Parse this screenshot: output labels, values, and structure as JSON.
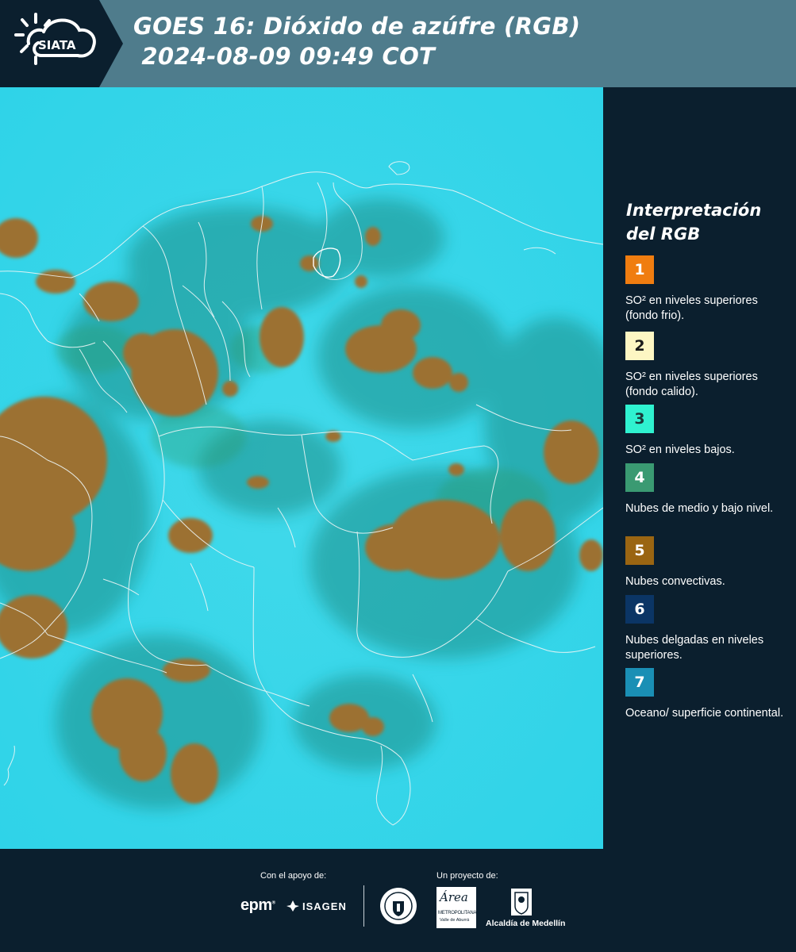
{
  "header": {
    "logo_text": "SIATA",
    "title_line1": "GOES 16: Dióxido de azúfre (RGB)",
    "title_line2": " 2024-08-09 09:49 COT"
  },
  "legend": {
    "title_line1": "Interpretación",
    "title_line2": "del RGB",
    "items": [
      {
        "number": "1",
        "color": "#f07d10",
        "text_color": "#ffffff",
        "label": "SO² en niveles superiores (fondo frio)."
      },
      {
        "number": "2",
        "color": "#fdf6c3",
        "text_color": "#1a1a1a",
        "label": "SO² en niveles superiores (fondo calido)."
      },
      {
        "number": "3",
        "color": "#2ff2d0",
        "text_color": "#1a3a3a",
        "label": "SO² en niveles bajos."
      },
      {
        "number": "4",
        "color": "#3a9a72",
        "text_color": "#ffffff",
        "label": "Nubes de medio y bajo nivel."
      },
      {
        "number": "5",
        "color": "#9a6512",
        "text_color": "#ffffff",
        "label": "Nubes convectivas."
      },
      {
        "number": "6",
        "color": "#0b3565",
        "text_color": "#ffffff",
        "label": "Nubes delgadas en niveles superiores."
      },
      {
        "number": "7",
        "color": "#1a8fb5",
        "text_color": "#ffffff",
        "label": "Oceano/ superficie continental."
      }
    ]
  },
  "footer": {
    "support_label": "Con el apoyo de:",
    "project_label": "Un proyecto de:",
    "sponsor_epm": "epm",
    "sponsor_isagen": "ISAGEN",
    "area_name": "Área",
    "area_sub1": "METROPOLITANA",
    "area_sub2": "Valle de Aburrá",
    "alcaldia": "Alcaldía de Medellín"
  },
  "colors": {
    "header_bg": "#4f7c8c",
    "page_bg": "#0b1f2e",
    "sky_cyan": "#38d4e6",
    "cloud_brown": "#a27630"
  }
}
